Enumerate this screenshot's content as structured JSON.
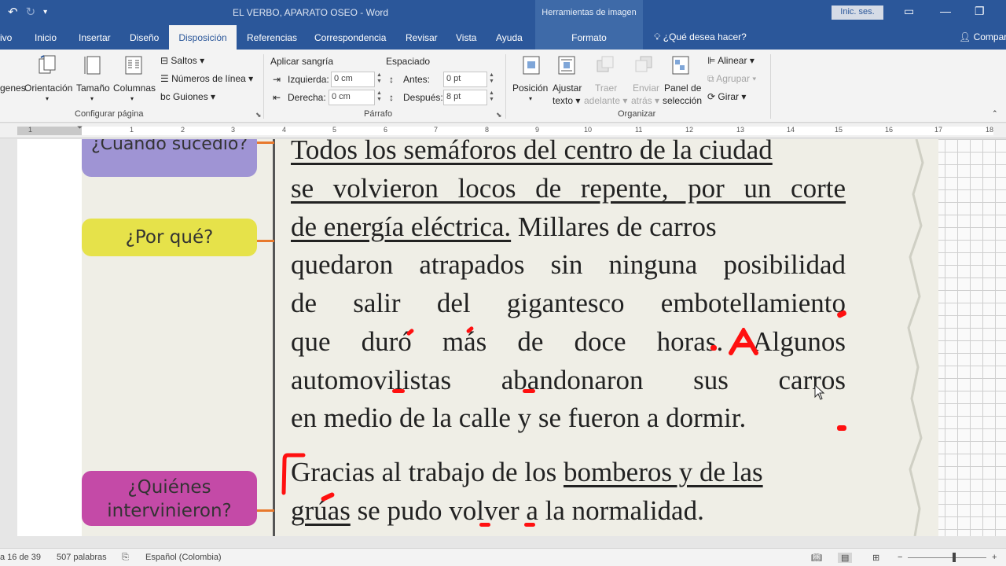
{
  "titlebar": {
    "doc_title": "EL VERBO, APARATO OSEO  -  Word",
    "context_title": "Herramientas de imagen",
    "signin": "Inic. ses."
  },
  "tabs": {
    "file": "ivo",
    "home": "Inicio",
    "insert": "Insertar",
    "design": "Diseño",
    "layout": "Disposición",
    "references": "Referencias",
    "mailings": "Correspondencia",
    "review": "Revisar",
    "view": "Vista",
    "help": "Ayuda",
    "format": "Formato",
    "tellme": "¿Qué desea hacer?",
    "share": "Compar"
  },
  "ribbon": {
    "margins": "genes",
    "orientation": "Orientación",
    "size": "Tamaño",
    "columns": "Columnas",
    "breaks": "Saltos",
    "line_numbers": "Números de línea",
    "hyphenation": "Guiones",
    "page_setup_group": "Configurar página",
    "indent_title": "Aplicar sangría",
    "indent_left_label": "Izquierda:",
    "indent_left_value": "0 cm",
    "indent_right_label": "Derecha:",
    "indent_right_value": "0 cm",
    "spacing_title": "Espaciado",
    "spacing_before_label": "Antes:",
    "spacing_before_value": "0 pt",
    "spacing_after_label": "Después:",
    "spacing_after_value": "8 pt",
    "paragraph_group": "Párrafo",
    "position_label": "Posición",
    "wrap_label_1": "Ajustar",
    "wrap_label_2": "texto",
    "forward_label_1": "Traer",
    "forward_label_2": "adelante",
    "backward_label_1": "Enviar",
    "backward_label_2": "atrás",
    "selection_pane_1": "Panel de",
    "selection_pane_2": "selección",
    "align": "Alinear",
    "group": "Agrupar",
    "rotate": "Girar",
    "arrange_group": "Organizar"
  },
  "ruler": {
    "numbers": [
      "1",
      "1",
      "2",
      "3",
      "4",
      "5",
      "6",
      "7",
      "8",
      "9",
      "10",
      "11",
      "12",
      "13",
      "14",
      "15",
      "16",
      "17",
      "18"
    ]
  },
  "image": {
    "pill_when": "¿Cuándo sucedió?",
    "pill_why": "¿Por qué?",
    "pill_who_1": "¿Quiénes",
    "pill_who_2": "intervinieron?",
    "lines": [
      "Todos los semáforos del centro de la ciudad",
      "se volvieron locos de repente, por un corte",
      "de energía eléctrica.",
      " Millares de carros",
      "quedaron atrapados  sin ninguna posibilidad",
      "de salir del gigantesco embotellamiento",
      "que duró más de doce horas. Algunos",
      "automovilistas abandonaron sus carros",
      "en medio de la calle y se fueron a dormir.",
      "Gracias al trabajo de los ",
      "bomberos y de las",
      "grúas",
      "  se pudo volver a la normalidad."
    ]
  },
  "status": {
    "page": "a 16 de 39",
    "words": "507 palabras",
    "language": "Español (Colombia)"
  },
  "colors": {
    "word_blue": "#2b579a",
    "context_blue": "#3e6aa8",
    "connector_orange": "#e8792d",
    "ink_red": "#ff1010"
  }
}
